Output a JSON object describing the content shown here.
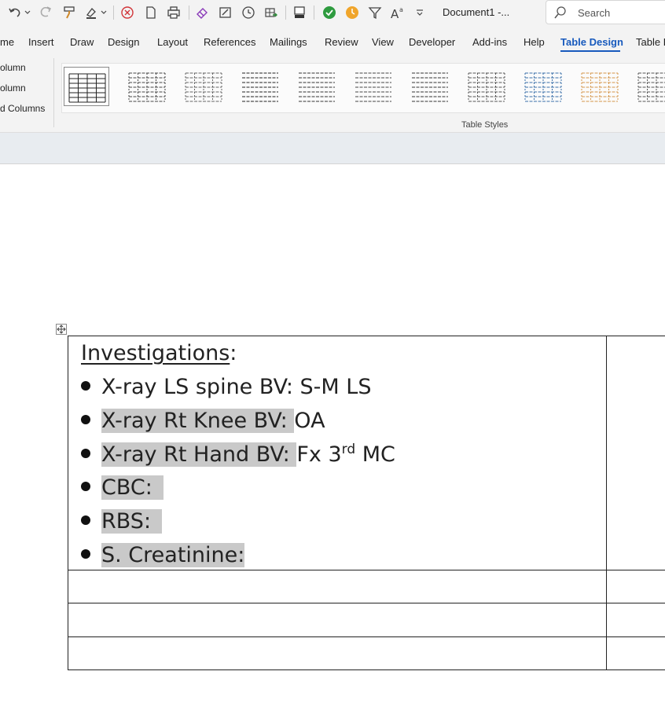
{
  "window": {
    "doc_title": "Document1  -...",
    "search_placeholder": "Search"
  },
  "quick_access": {
    "icons": [
      "undo-icon",
      "redo-icon",
      "format-painter-icon",
      "highlight-icon",
      "cancel-icon",
      "new-document-icon",
      "print-icon",
      "eraser-icon",
      "edit-form-icon",
      "clock-icon",
      "table-export-icon",
      "fill-color-icon",
      "accept-icon",
      "timer-icon",
      "filter-icon",
      "font-size-icon",
      "customize-icon"
    ]
  },
  "ribbon": {
    "tabs": [
      "me",
      "Insert",
      "Draw",
      "Design",
      "Layout",
      "References",
      "Mailings",
      "Review",
      "View",
      "Developer",
      "Add-ins",
      "Help",
      "Table Design",
      "Table L"
    ],
    "active_tab": "Table Design",
    "options": [
      "olumn",
      "olumn",
      "d Columns"
    ],
    "group_label": "Table Styles"
  },
  "document": {
    "heading": "Investigations",
    "heading_colon": ":",
    "items": [
      {
        "label": "X-ray LS spine BV: ",
        "value": "S-M LS",
        "sup": "",
        "tail": "",
        "highlight": ""
      },
      {
        "label": "X-ray Rt Knee BV: ",
        "value": "OA",
        "sup": "",
        "tail": "",
        "highlight": "label"
      },
      {
        "label": "X-ray Rt Hand BV: ",
        "value": "Fx 3",
        "sup": "rd",
        "tail": " MC",
        "highlight": "label"
      },
      {
        "label": "CBC: ",
        "value": "",
        "sup": "",
        "tail": "",
        "highlight": "label"
      },
      {
        "label": "RBS: ",
        "value": "",
        "sup": "",
        "tail": "",
        "highlight": "label"
      },
      {
        "label": "S. Creatinine: ",
        "value": "",
        "sup": "",
        "tail": "",
        "highlight": "label"
      }
    ]
  },
  "colors": {
    "accent": "#185abd",
    "highlight": "#c9c9c9",
    "ribbon_bg": "#f3f3f3",
    "text": "#111111"
  }
}
